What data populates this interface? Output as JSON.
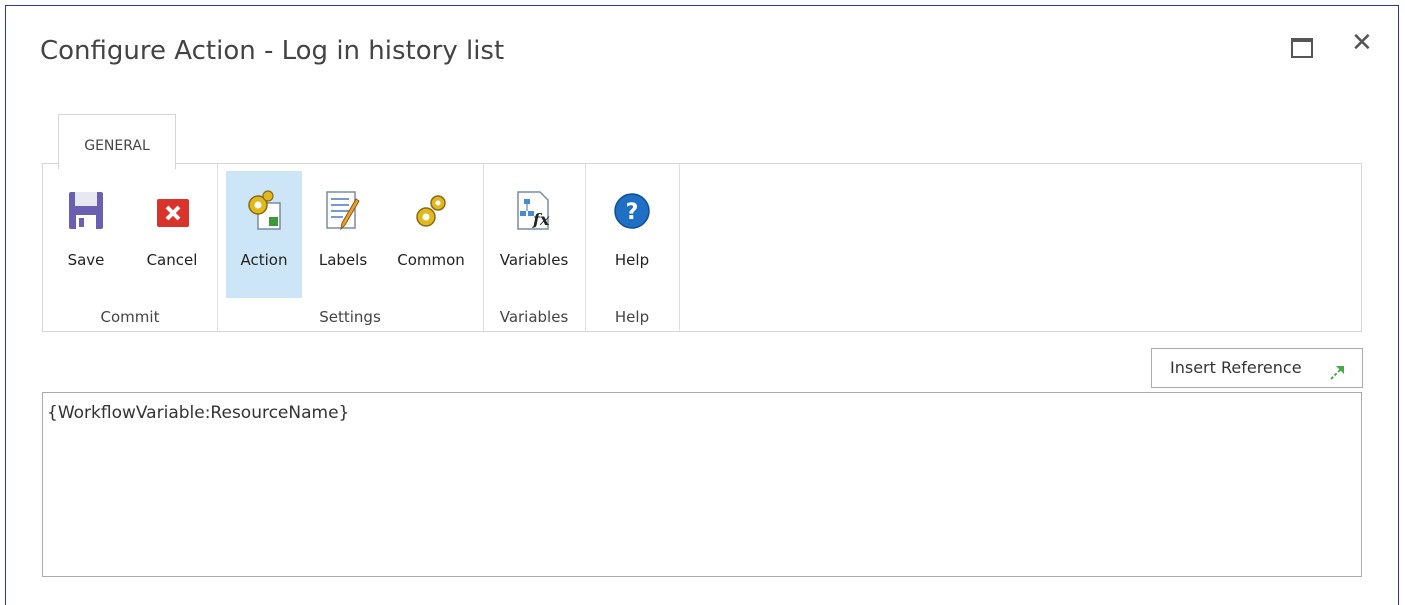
{
  "dialog": {
    "title": "Configure Action - Log in history list"
  },
  "tabs": [
    {
      "label": "GENERAL"
    }
  ],
  "ribbon": {
    "groups": [
      {
        "label": "Commit",
        "buttons": [
          {
            "label": "Save",
            "icon": "floppy-disk-icon"
          },
          {
            "label": "Cancel",
            "icon": "cancel-x-icon"
          }
        ]
      },
      {
        "label": "Settings",
        "buttons": [
          {
            "label": "Action",
            "icon": "gear-document-icon",
            "selected": true
          },
          {
            "label": "Labels",
            "icon": "notepad-pencil-icon"
          },
          {
            "label": "Common",
            "icon": "gears-icon"
          }
        ]
      },
      {
        "label": "Variables",
        "buttons": [
          {
            "label": "Variables",
            "icon": "fx-workflow-icon"
          }
        ]
      },
      {
        "label": "Help",
        "buttons": [
          {
            "label": "Help",
            "icon": "help-question-icon"
          }
        ]
      }
    ]
  },
  "insert_reference": {
    "label": "Insert Reference"
  },
  "message": {
    "value": "{WorkflowVariable:ResourceName}"
  },
  "colors": {
    "accent_border": "#2a34b5",
    "selected_bg": "#cde6f7",
    "cancel_red": "#d9342b",
    "help_blue": "#1f6fc5"
  }
}
